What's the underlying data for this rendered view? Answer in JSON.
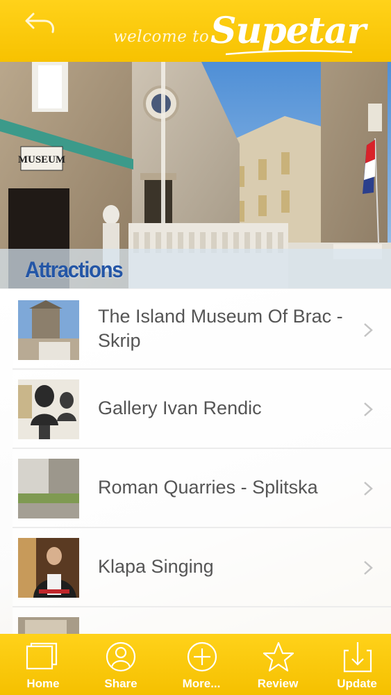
{
  "header": {
    "welcome_text": "welcome to",
    "brand_name": "Supetar"
  },
  "hero": {
    "museum_sign": "MUSEUM"
  },
  "section": {
    "title": "Attractions"
  },
  "attractions": [
    {
      "name": "The Island Museum Of Brac - Skrip"
    },
    {
      "name": "Gallery Ivan Rendic"
    },
    {
      "name": "Roman Quarries - Splitska"
    },
    {
      "name": "Klapa Singing"
    }
  ],
  "tabbar": {
    "items": [
      {
        "label": "Home",
        "icon": "home-icon"
      },
      {
        "label": "Share",
        "icon": "share-icon"
      },
      {
        "label": "More...",
        "icon": "more-icon"
      },
      {
        "label": "Review",
        "icon": "star-icon"
      },
      {
        "label": "Update",
        "icon": "download-icon"
      }
    ]
  },
  "colors": {
    "header_yellow": "#f7c200",
    "section_title_blue": "#2456a6",
    "list_text": "#555555"
  }
}
